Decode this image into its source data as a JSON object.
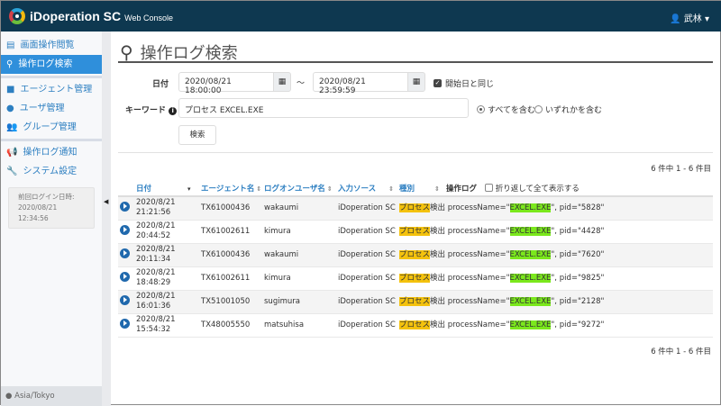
{
  "header": {
    "brand": "iDoperation SC",
    "subtitle": "Web Console",
    "user": "武林"
  },
  "sidebar": {
    "items": [
      {
        "label": "画面操作閲覧",
        "icon": "▤"
      },
      {
        "label": "操作ログ検索",
        "icon": "🔍"
      },
      {
        "label": "エージェント管理",
        "icon": "■"
      },
      {
        "label": "ユーザ管理",
        "icon": "●"
      },
      {
        "label": "グループ管理",
        "icon": "👥"
      },
      {
        "label": "操作ログ通知",
        "icon": "📢"
      },
      {
        "label": "システム設定",
        "icon": "🔧"
      }
    ],
    "last_login_label": "前回ログイン日時:",
    "last_login": "2020/08/21 12:34:56",
    "timezone": "Asia/Tokyo"
  },
  "page": {
    "title": "操作ログ検索"
  },
  "form": {
    "date_label": "日付",
    "date_from": "2020/08/21 18:00:00",
    "tilde": "～",
    "date_to": "2020/08/21 23:59:59",
    "same_day": "開始日と同じ",
    "keyword_label": "キーワード",
    "keyword": "プロセス EXCEL.EXE",
    "opt_all": "すべてを含む",
    "opt_any": "いずれかを含む",
    "search": "検索"
  },
  "count": "6 件中 1 - 6 件目",
  "table": {
    "headers": [
      "日付",
      "エージェント名",
      "ログオンユーザ名",
      "入力ソース",
      "種別",
      "操作ログ"
    ],
    "wrap_label": "折り返して全て表示する",
    "rows": [
      {
        "date": "2020/8/21",
        "time": "21:21:56",
        "agent": "TX61000436",
        "user": "wakaumi",
        "source": "iDoperation SC",
        "kind": "プロセス",
        "pre": "検出 processName=\"",
        "proc": "EXCEL.EXE",
        "post": "\", pid=\"5828\""
      },
      {
        "date": "2020/8/21",
        "time": "20:44:52",
        "agent": "TX61002611",
        "user": "kimura",
        "source": "iDoperation SC",
        "kind": "プロセス",
        "pre": "検出 processName=\"",
        "proc": "EXCEL.EXE",
        "post": "\", pid=\"4428\""
      },
      {
        "date": "2020/8/21",
        "time": "20:11:34",
        "agent": "TX61000436",
        "user": "wakaumi",
        "source": "iDoperation SC",
        "kind": "プロセス",
        "pre": "検出 processName=\"",
        "proc": "EXCEL.EXE",
        "post": "\", pid=\"7620\""
      },
      {
        "date": "2020/8/21",
        "time": "18:48:29",
        "agent": "TX61002611",
        "user": "kimura",
        "source": "iDoperation SC",
        "kind": "プロセス",
        "pre": "検出 processName=\"",
        "proc": "EXCEL.EXE",
        "post": "\", pid=\"9825\""
      },
      {
        "date": "2020/8/21",
        "time": "16:01:36",
        "agent": "TX51001050",
        "user": "sugimura",
        "source": "iDoperation SC",
        "kind": "プロセス",
        "pre": "検出 processName=\"",
        "proc": "EXCEL.EXE",
        "post": "\", pid=\"2128\""
      },
      {
        "date": "2020/8/21",
        "time": "15:54:32",
        "agent": "TX48005550",
        "user": "matsuhisa",
        "source": "iDoperation SC",
        "kind": "プロセス",
        "pre": "検出 processName=\"",
        "proc": "EXCEL.EXE",
        "post": "\", pid=\"9272\""
      }
    ]
  }
}
